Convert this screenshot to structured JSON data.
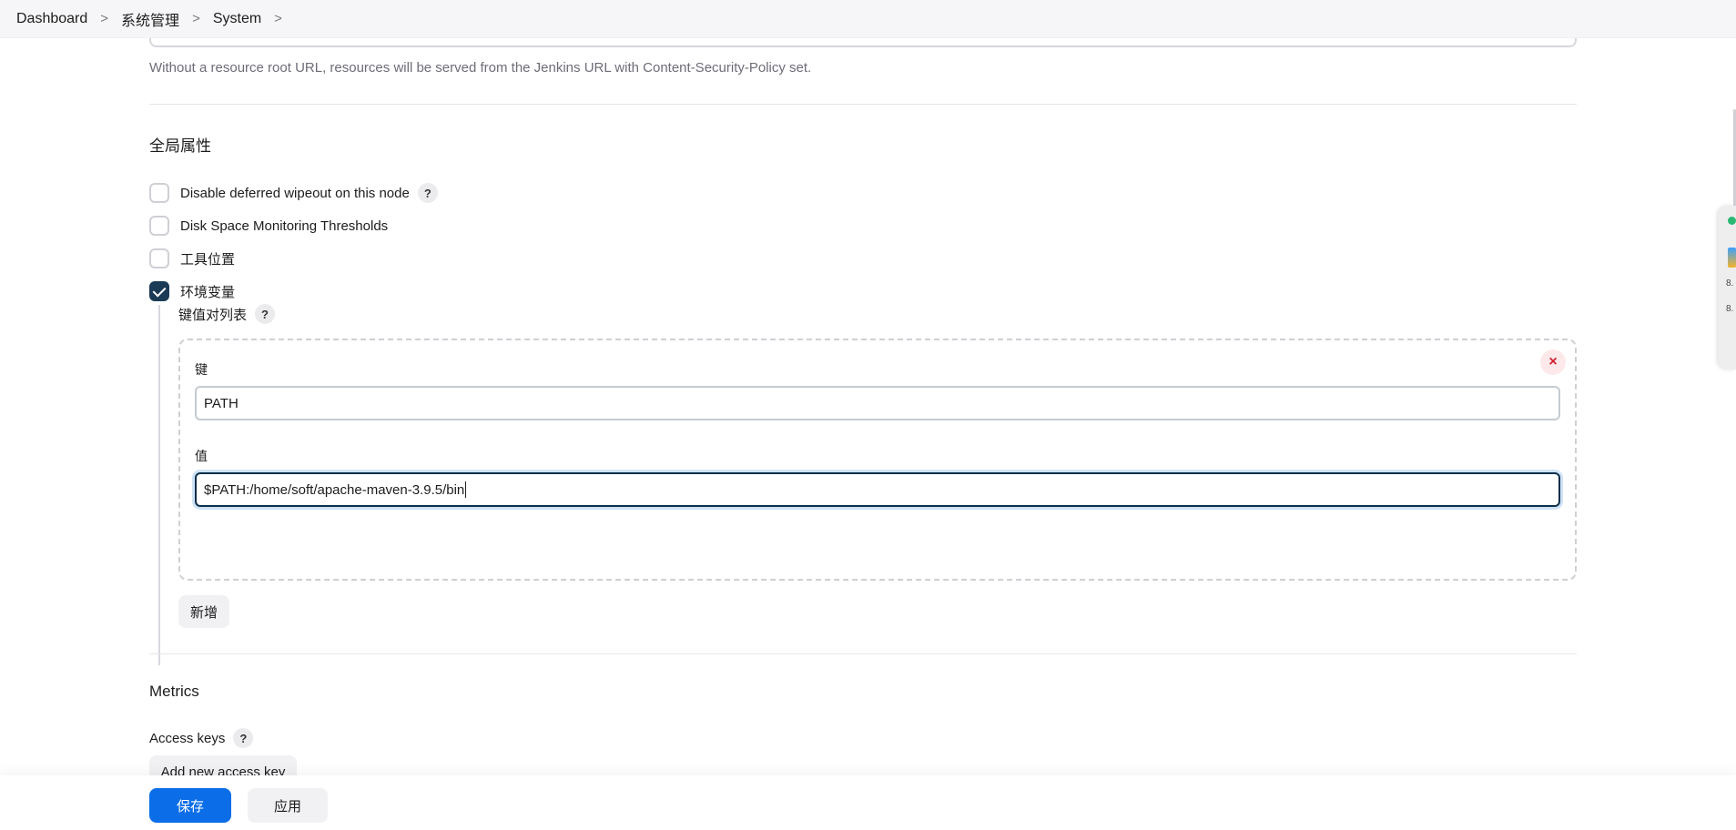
{
  "breadcrumb": {
    "items": [
      "Dashboard",
      "系统管理",
      "System"
    ],
    "separator": ">"
  },
  "resource_root": {
    "description": "Without a resource root URL, resources will be served from the Jenkins URL with Content-Security-Policy set."
  },
  "global_properties": {
    "title": "全局属性",
    "options": [
      {
        "label": "Disable deferred wipeout on this node",
        "checked": false,
        "help": "?"
      },
      {
        "label": "Disk Space Monitoring Thresholds",
        "checked": false
      },
      {
        "label": "工具位置",
        "checked": false
      },
      {
        "label": "环境变量",
        "checked": true
      }
    ],
    "env_vars": {
      "list_label": "键值对列表",
      "help": "?",
      "entry": {
        "remove_icon": "×",
        "key_label": "键",
        "key_value": "PATH",
        "value_label": "值",
        "value_value": "$PATH:/home/soft/apache-maven-3.9.5/bin"
      },
      "add_label": "新增"
    }
  },
  "metrics": {
    "title": "Metrics",
    "access_keys_label": "Access keys",
    "help": "?",
    "add_key_label": "Add new access key"
  },
  "footer": {
    "save_label": "保存",
    "apply_label": "应用"
  },
  "side_widget": {
    "line1": "8.",
    "line2": "8."
  },
  "colors": {
    "primary": "#0b6ee8",
    "checked": "#1a3a55",
    "danger": "#d21f33"
  }
}
